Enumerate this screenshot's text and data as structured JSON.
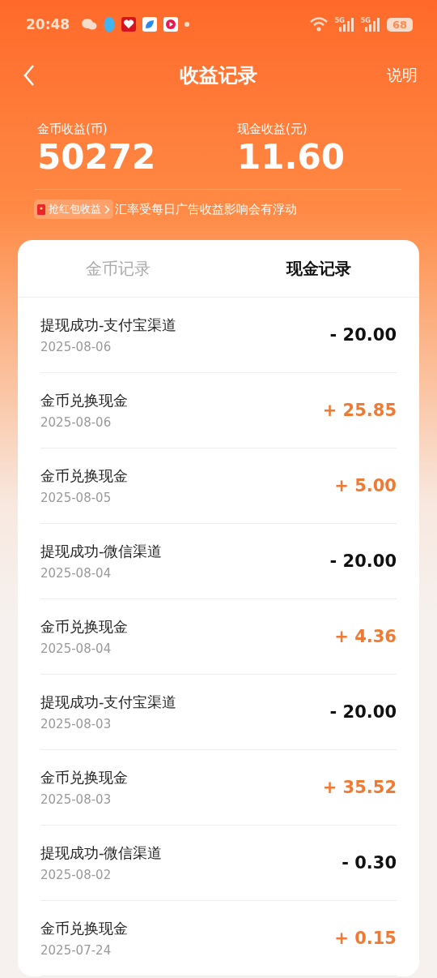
{
  "status_bar": {
    "time": "20:48",
    "signals": [
      {
        "label": "5G"
      },
      {
        "label": "5G"
      }
    ],
    "battery": "68"
  },
  "header": {
    "title": "收益记录",
    "action": "说明"
  },
  "summary": [
    {
      "label": "金币收益(币)",
      "value": "50272"
    },
    {
      "label": "现金收益(元)",
      "value": "11.60"
    }
  ],
  "notice": {
    "tag": "抢红包收益",
    "text": "汇率受每日广告收益影响会有浮动"
  },
  "tabs": [
    {
      "label": "金币记录",
      "selected": false
    },
    {
      "label": "现金记录",
      "selected": true
    }
  ],
  "records": [
    {
      "title": "提现成功-支付宝渠道",
      "date": "2025-08-06",
      "amount": "- 20.00",
      "kind": "withdrawal"
    },
    {
      "title": "金币兑换现金",
      "date": "2025-08-06",
      "amount": "+ 25.85",
      "kind": "income"
    },
    {
      "title": "金币兑换现金",
      "date": "2025-08-05",
      "amount": "+ 5.00",
      "kind": "income"
    },
    {
      "title": "提现成功-微信渠道",
      "date": "2025-08-04",
      "amount": "- 20.00",
      "kind": "withdrawal"
    },
    {
      "title": "金币兑换现金",
      "date": "2025-08-04",
      "amount": "+ 4.36",
      "kind": "income"
    },
    {
      "title": "提现成功-支付宝渠道",
      "date": "2025-08-03",
      "amount": "- 20.00",
      "kind": "withdrawal"
    },
    {
      "title": "金币兑换现金",
      "date": "2025-08-03",
      "amount": "+ 35.52",
      "kind": "income"
    },
    {
      "title": "提现成功-微信渠道",
      "date": "2025-08-02",
      "amount": "- 0.30",
      "kind": "withdrawal"
    },
    {
      "title": "金币兑换现金",
      "date": "2025-07-24",
      "amount": "+ 0.15",
      "kind": "income"
    }
  ]
}
